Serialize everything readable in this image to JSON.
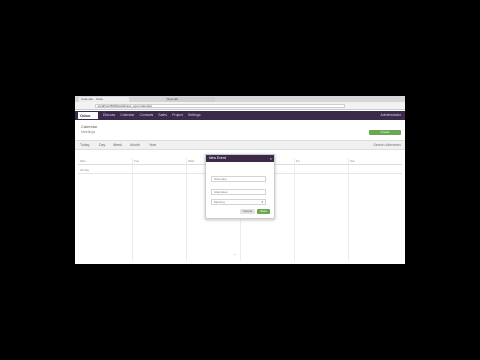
{
  "browser": {
    "tabs": [
      {
        "label": "Calendar - Odoo"
      },
      {
        "label": "New tab"
      }
    ],
    "url": "localhost:8069/web#view_type=calendar"
  },
  "navbar": {
    "brand": "Odoo",
    "links": [
      "Discuss",
      "Calendar",
      "Contacts",
      "Sales",
      "Project",
      "Settings"
    ],
    "user": "Administrator"
  },
  "header": {
    "title": "Calendar",
    "subtitle": "Meetings",
    "create_label": "Create"
  },
  "toolbar": {
    "filters": [
      "Today",
      "Day",
      "Week",
      "Month",
      "Year"
    ],
    "right_text": "Search Attendees"
  },
  "calendar": {
    "columns": [
      "Mon",
      "Tue",
      "Wed",
      "Thu",
      "Fri",
      "Sat"
    ],
    "row_cells": [
      "All day",
      "",
      "",
      "",
      "",
      ""
    ]
  },
  "popup": {
    "title": "New Event",
    "close": "×",
    "summary_placeholder": "Summary",
    "attendees_placeholder": "Attendees",
    "type_value": "Meeting",
    "cancel_label": "Cancel",
    "save_label": "Save"
  },
  "colors": {
    "navbar": "#3b2a4a",
    "create": "#6aa84f"
  }
}
